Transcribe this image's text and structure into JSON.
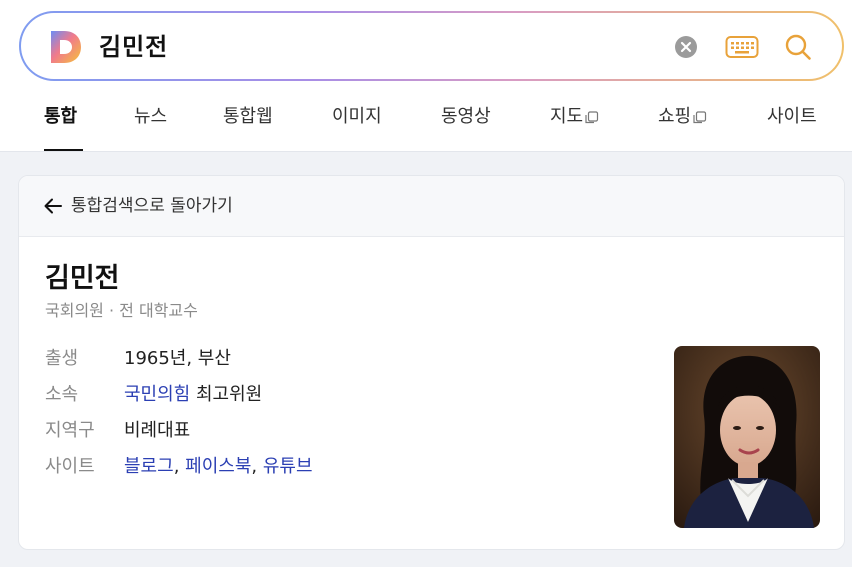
{
  "search": {
    "query": "김민전"
  },
  "tabs": [
    {
      "label": "통합"
    },
    {
      "label": "뉴스"
    },
    {
      "label": "통합웹"
    },
    {
      "label": "이미지"
    },
    {
      "label": "동영상"
    },
    {
      "label": "지도"
    },
    {
      "label": "쇼핑"
    },
    {
      "label": "사이트"
    }
  ],
  "card": {
    "back_label": "통합검색으로 돌아가기",
    "name": "김민전",
    "description": "국회의원 · 전 대학교수",
    "info": {
      "birth": {
        "key": "출생",
        "value": "1965년, 부산"
      },
      "affiliation": {
        "key": "소속",
        "party": "국민의힘",
        "role": "최고위원"
      },
      "district": {
        "key": "지역구",
        "value": "비례대표"
      },
      "site": {
        "key": "사이트",
        "blog": "블로그",
        "sep1": ",",
        "facebook": "페이스북",
        "sep2": ",",
        "youtube": "유튜브"
      }
    }
  },
  "colors": {
    "link": "#2b3fb3",
    "search_gradient": [
      "#7f9cf0",
      "#a88ee6",
      "#d89cc4",
      "#f0c06a"
    ],
    "accent_orange": "#e8a23a"
  },
  "icons": {
    "logo": "daum-d-logo",
    "clear": "clear-icon",
    "keyboard": "keyboard-icon",
    "search": "search-icon",
    "back": "arrow-left-icon",
    "external": "external-window-icon"
  }
}
